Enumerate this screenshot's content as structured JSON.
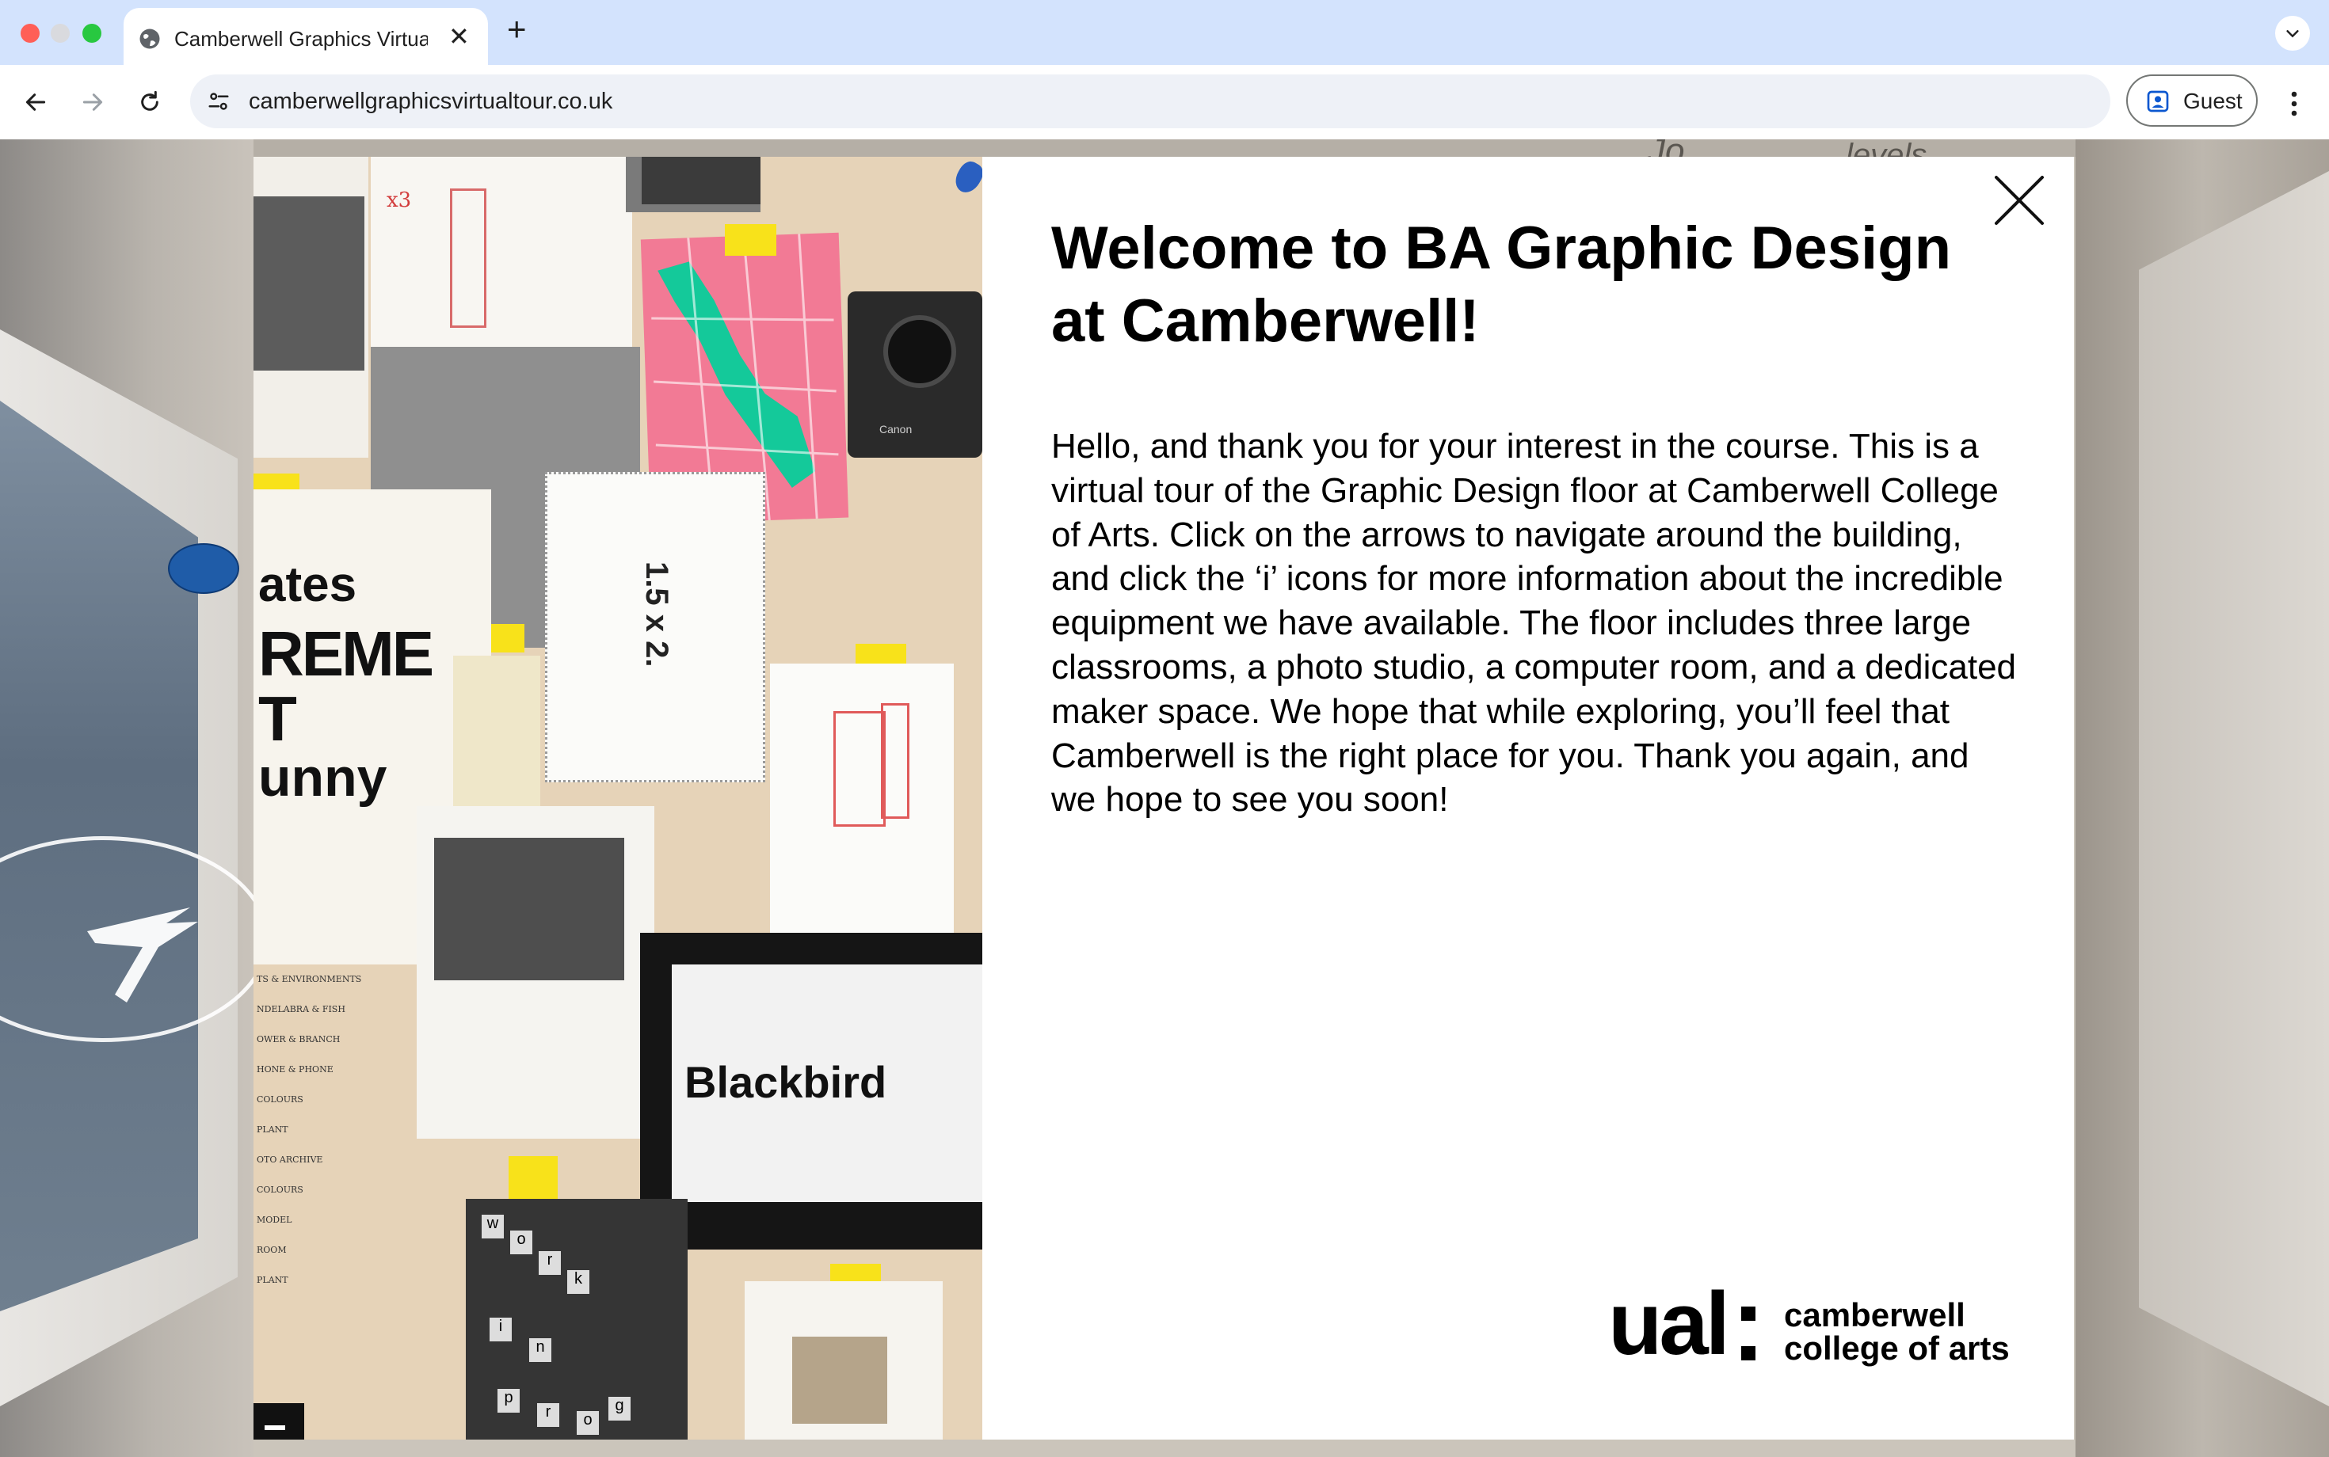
{
  "browser": {
    "tab_title": "Camberwell Graphics Virtual",
    "url": "camberwellgraphicsvirtualtour.co.uk",
    "profile_label": "Guest"
  },
  "collage": {
    "poster_lines": [
      "ates",
      "REME",
      "T",
      "unny"
    ],
    "blackbird_label": "Blackbird",
    "rotated_label": "1.5 x 2.",
    "sketch_note": "x3",
    "camera_brand": "Canon",
    "work_letters": [
      "w",
      "o",
      "r",
      "k",
      "i",
      "n",
      "p",
      "r",
      "o",
      "g"
    ],
    "archive_list": [
      "TS & ENVIRONMENTS",
      "NDELABRA & FISH",
      "OWER & BRANCH",
      "HONE & PHONE",
      "COLOURS",
      "PLANT",
      "OTO ARCHIVE",
      "COLOURS",
      "MODEL",
      "ROOM",
      "PLANT"
    ]
  },
  "welcome": {
    "title": "Welcome to BA Graphic Design at Camberwell!",
    "body": "Hello, and thank you for your interest in the course. This is a virtual tour of the Graphic Design floor at Camberwell College of Arts. Click on the arrows to navigate around the building, and click the ‘i’ icons for more information about the incredible equipment we have available. The floor includes three large classrooms, a photo studio, a computer room, and a dedicated maker space. We hope that while exploring, you’ll feel that Camberwell is the right place for you. Thank you again, and we hope to see you soon!"
  },
  "logo": {
    "mark": "ual",
    "line1": "camberwell",
    "line2": "college of arts"
  },
  "scene": {
    "ceiling_text": [
      "Jo",
      "levels"
    ]
  },
  "colors": {
    "tab_strip": "#d3e3fd",
    "modal_bg": "#ffffff",
    "pink_map": "#f27a95",
    "green_map": "#14c99a",
    "tape_yellow": "#f8e21a"
  }
}
